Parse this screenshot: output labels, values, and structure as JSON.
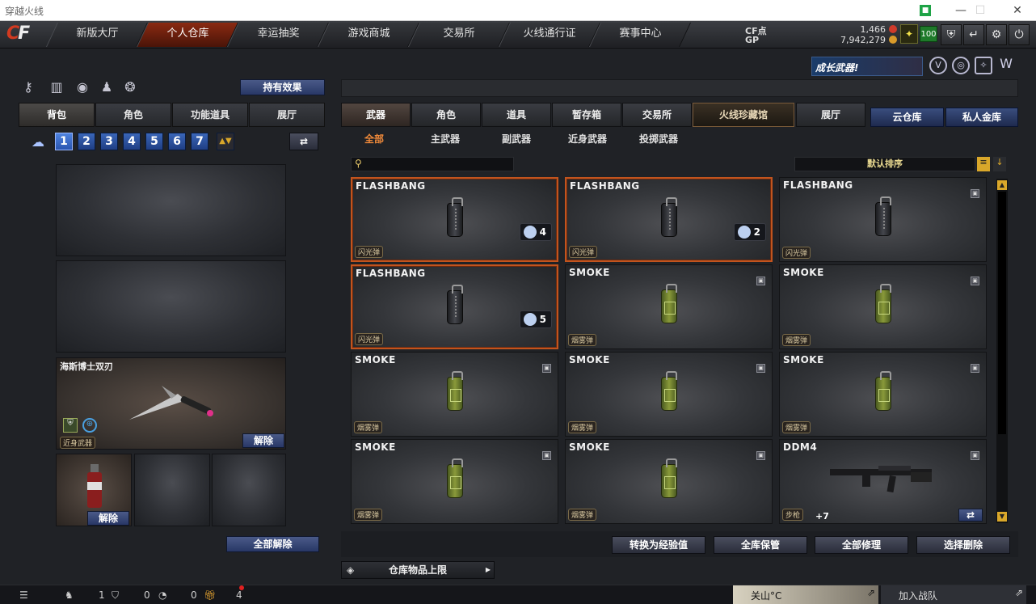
{
  "window": {
    "title": "穿越火线"
  },
  "nav": {
    "tabs": [
      "新版大厅",
      "个人仓库",
      "幸运抽奖",
      "游戏商城",
      "交易所",
      "火线通行证",
      "赛事中心"
    ],
    "active_index": 1
  },
  "currency": {
    "cf_label": "CF点",
    "cf_value": "1,466",
    "gp_label": "GP",
    "gp_value": "7,942,279",
    "level_badge": "100"
  },
  "banner": {
    "text": "成长武器!"
  },
  "left": {
    "effect_button": "持有效果",
    "tabs": [
      "背包",
      "角色",
      "功能道具",
      "展厅"
    ],
    "pages": [
      "1",
      "2",
      "3",
      "4",
      "5",
      "6",
      "7"
    ],
    "melee": {
      "name": "海斯博士双刃",
      "tag": "近身武器",
      "remove": "解除"
    },
    "grenade_slot": {
      "remove": "解除"
    },
    "remove_all": "全部解除"
  },
  "right": {
    "tabs": [
      "武器",
      "角色",
      "道具",
      "暂存箱",
      "交易所",
      "火线珍藏馆",
      "展厅"
    ],
    "cloud": "云仓库",
    "private": "私人金库",
    "subtabs": [
      "全部",
      "主武器",
      "副武器",
      "近身武器",
      "投掷武器"
    ],
    "sort": "默认排序",
    "items": [
      {
        "name": "FLASHBANG",
        "tag": "闪光弹",
        "kind": "flash",
        "count": "4",
        "selected": true
      },
      {
        "name": "FLASHBANG",
        "tag": "闪光弹",
        "kind": "flash",
        "count": "2",
        "selected": true
      },
      {
        "name": "FLASHBANG",
        "tag": "闪光弹",
        "kind": "flash",
        "count": "",
        "selected": false
      },
      {
        "name": "FLASHBANG",
        "tag": "闪光弹",
        "kind": "flash",
        "count": "5",
        "selected": true
      },
      {
        "name": "SMOKE",
        "tag": "烟雾弹",
        "kind": "smoke",
        "count": "",
        "selected": false
      },
      {
        "name": "SMOKE",
        "tag": "烟雾弹",
        "kind": "smoke",
        "count": "",
        "selected": false
      },
      {
        "name": "SMOKE",
        "tag": "烟雾弹",
        "kind": "smoke",
        "count": "",
        "selected": false
      },
      {
        "name": "SMOKE",
        "tag": "烟雾弹",
        "kind": "smoke",
        "count": "",
        "selected": false
      },
      {
        "name": "SMOKE",
        "tag": "烟雾弹",
        "kind": "smoke",
        "count": "",
        "selected": false
      },
      {
        "name": "SMOKE",
        "tag": "烟雾弹",
        "kind": "smoke",
        "count": "",
        "selected": false
      },
      {
        "name": "SMOKE",
        "tag": "烟雾弹",
        "kind": "smoke",
        "count": "",
        "selected": false
      },
      {
        "name": "DDM4",
        "tag": "步枪",
        "kind": "rifle",
        "count": "",
        "selected": false,
        "upgrade": "+7"
      }
    ],
    "actions": [
      "转换为经验值",
      "全库保管",
      "全部修理",
      "选择删除"
    ],
    "warehouse_limit": "仓库物品上限"
  },
  "bottom": {
    "count1": "1",
    "count2": "0",
    "count3": "0",
    "count4": "4",
    "chat_channel": "关山°C",
    "join_team": "加入战队"
  }
}
